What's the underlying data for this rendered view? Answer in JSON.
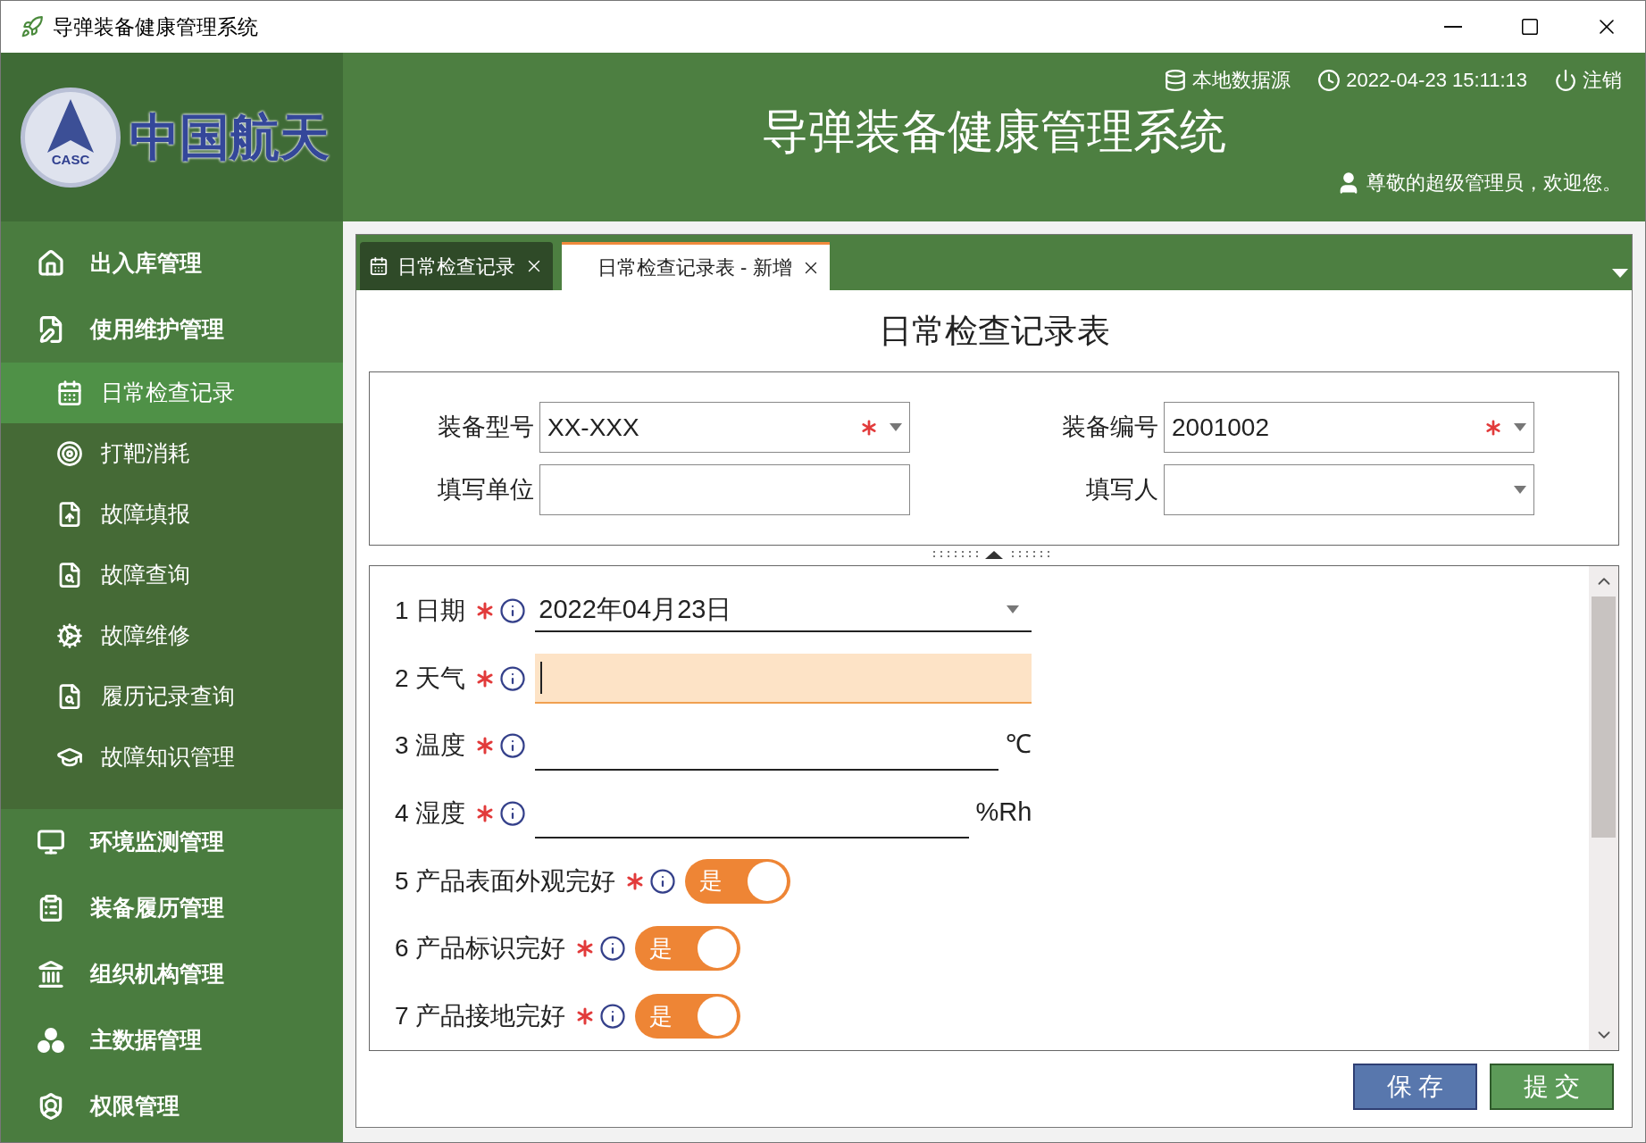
{
  "window": {
    "title": "导弹装备健康管理系统"
  },
  "logo": {
    "emblem_text": "CASC",
    "name": "中国航天"
  },
  "header": {
    "data_source": "本地数据源",
    "datetime": "2022-04-23 15:11:13",
    "logout": "注销",
    "title": "导弹装备健康管理系统",
    "welcome": "尊敬的超级管理员，欢迎您。"
  },
  "sidebar": {
    "items": [
      {
        "label": "出入库管理"
      },
      {
        "label": "使用维护管理",
        "expanded": true,
        "children": [
          {
            "label": "日常检查记录",
            "selected": true
          },
          {
            "label": "打靶消耗",
            "selected": false
          },
          {
            "label": "故障填报",
            "selected": false
          },
          {
            "label": "故障查询",
            "selected": false
          },
          {
            "label": "故障维修",
            "selected": false
          },
          {
            "label": "履历记录查询",
            "selected": false
          },
          {
            "label": "故障知识管理",
            "selected": false
          }
        ]
      },
      {
        "label": "环境监测管理"
      },
      {
        "label": "装备履历管理"
      },
      {
        "label": "组织机构管理"
      },
      {
        "label": "主数据管理"
      },
      {
        "label": "权限管理"
      }
    ]
  },
  "tabs": [
    {
      "label": "日常检查记录",
      "selected": false
    },
    {
      "label": "日常检查记录表 - 新增",
      "selected": true
    }
  ],
  "form": {
    "title": "日常检查记录表",
    "header_fields": [
      {
        "label": "装备型号",
        "value": "XX-XXX",
        "required": true,
        "dropdown": true
      },
      {
        "label": "装备编号",
        "value": "2001002",
        "required": true,
        "dropdown": true
      },
      {
        "label": "填写单位",
        "required": false,
        "dropdown": false
      },
      {
        "label": "填写人",
        "required": false,
        "dropdown": true
      }
    ],
    "questions": [
      {
        "number": "1",
        "label": "日期",
        "kind": "date",
        "value": "2022年04月23日"
      },
      {
        "number": "2",
        "label": "天气",
        "kind": "text",
        "focused": true
      },
      {
        "number": "3",
        "label": "温度",
        "kind": "text",
        "unit": "℃",
        "focused": false
      },
      {
        "number": "4",
        "label": "湿度",
        "kind": "text",
        "unit": "%Rh",
        "focused": false
      },
      {
        "number": "5",
        "label": "产品表面外观完好",
        "kind": "toggle",
        "on": true,
        "on_label": "是"
      },
      {
        "number": "6",
        "label": "产品标识完好",
        "kind": "toggle",
        "on": true,
        "on_label": "是"
      },
      {
        "number": "7",
        "label": "产品接地完好",
        "kind": "toggle",
        "on": true,
        "on_label": "是"
      }
    ]
  },
  "buttons": [
    {
      "label": "保 存",
      "kind": "save"
    },
    {
      "label": "提 交",
      "kind": "submit"
    }
  ]
}
